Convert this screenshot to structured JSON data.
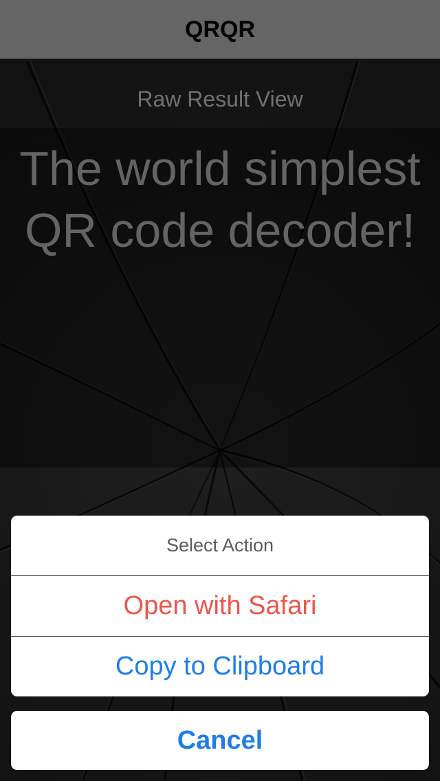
{
  "app": {
    "title": "QRQR"
  },
  "main": {
    "section_label": "Raw Result View",
    "result_text": "The world simplest QR code decoder!"
  },
  "action_sheet": {
    "title": "Select Action",
    "actions": [
      {
        "label": "Open with Safari",
        "color": "#f0544a"
      },
      {
        "label": "Copy to Clipboard",
        "color": "#1e7ee6"
      }
    ],
    "cancel_label": "Cancel"
  },
  "colors": {
    "nav_bar": "#7c7c7c",
    "background": "#1b1b1b",
    "destructive": "#f0544a",
    "accent": "#1e7ee6"
  }
}
